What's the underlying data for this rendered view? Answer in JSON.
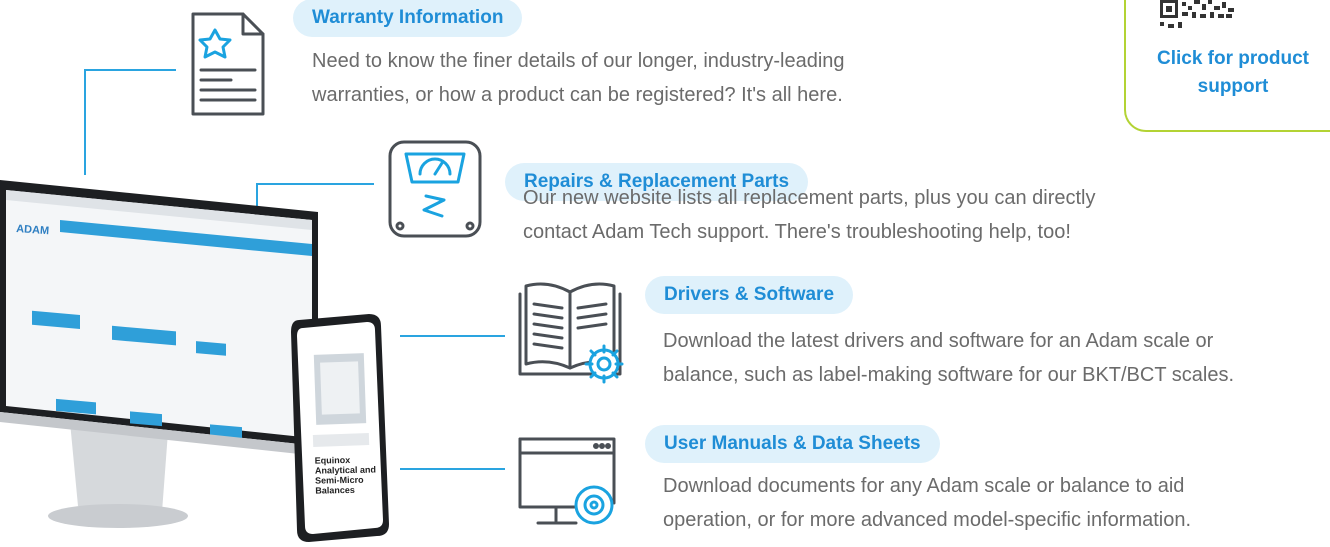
{
  "support_box": {
    "label": "Click for product support",
    "accent_color": "#b3d334"
  },
  "sections": [
    {
      "title": "Warranty Information",
      "description_line1": "Need to know the finer details of our longer, industry-leading",
      "description_line2": "warranties, or how a product can be registered? It's all here.",
      "icon": "document-star-icon"
    },
    {
      "title": "Repairs & Replacement Parts",
      "description_line1": "Our new website lists all replacement parts, plus you can directly",
      "description_line2": "contact Adam Tech support. There's troubleshooting help, too!",
      "icon": "broken-scale-icon"
    },
    {
      "title": "Drivers & Software",
      "description_line1": "Download the latest drivers and software for an Adam scale or",
      "description_line2": "balance, such as label-making software for our BKT/BCT scales.",
      "icon": "book-gear-icon"
    },
    {
      "title": "User Manuals & Data Sheets",
      "description_line1": "Download documents for any Adam scale or balance to aid",
      "description_line2": "operation, or for more advanced model-specific information.",
      "icon": "monitor-disc-icon"
    }
  ],
  "devices": {
    "monitor_brand": "ADAM",
    "phone_caption": "Equinox Analytical and Semi-Micro Balances"
  },
  "colors": {
    "accent_blue": "#1f8dd6",
    "pill_background": "#dff1fb",
    "connector": "#2aa4e0",
    "icon_stroke": "#4a4f55",
    "icon_highlight": "#1aa3e0"
  }
}
